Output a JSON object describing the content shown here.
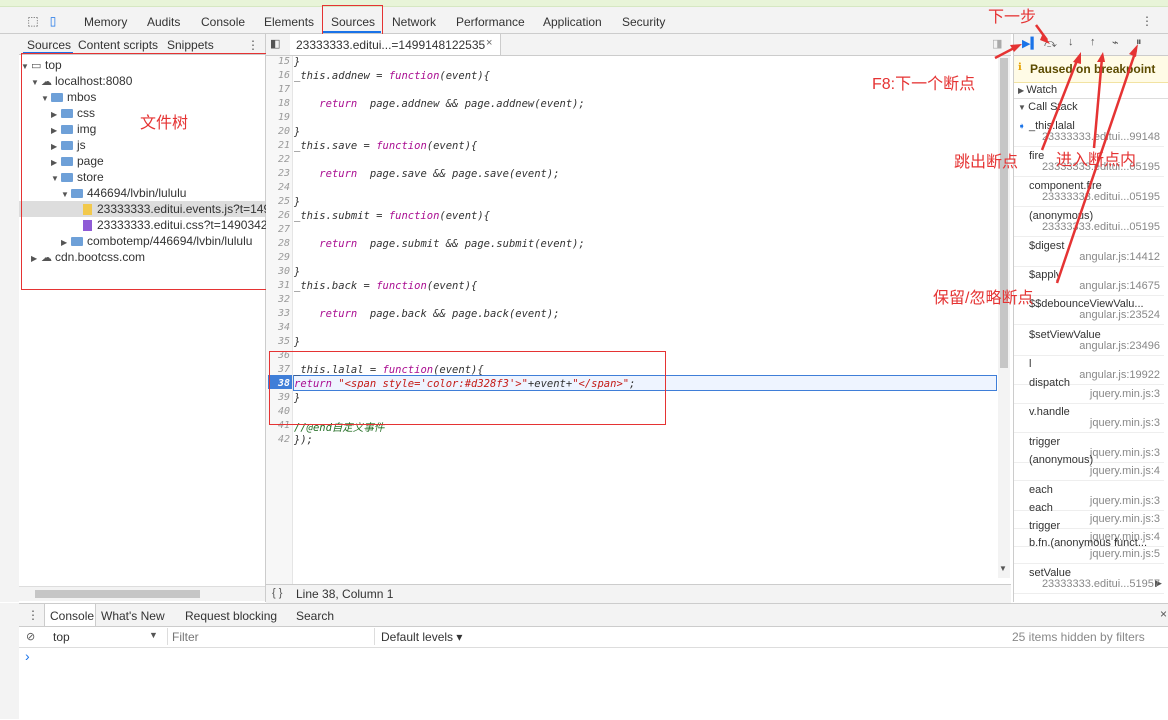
{
  "topbar": {
    "tabs": [
      "Memory",
      "Audits",
      "Console",
      "Elements",
      "Sources",
      "Network",
      "Performance",
      "Application",
      "Security"
    ],
    "active_tab": "Sources"
  },
  "sidebar": {
    "subtabs": [
      "Sources",
      "Content scripts",
      "Snippets"
    ],
    "tree": [
      {
        "label": "top",
        "kind": "frame"
      },
      {
        "label": "localhost:8080",
        "kind": "cloud"
      },
      {
        "label": "mbos",
        "kind": "folder"
      },
      {
        "label": "css",
        "kind": "folder"
      },
      {
        "label": "img",
        "kind": "folder"
      },
      {
        "label": "js",
        "kind": "folder"
      },
      {
        "label": "page",
        "kind": "folder"
      },
      {
        "label": "store",
        "kind": "folder"
      },
      {
        "label": "446694/lvbin/lululu",
        "kind": "folder"
      },
      {
        "label": "23333333.editui.events.js?t=149",
        "kind": "js"
      },
      {
        "label": "23333333.editui.css?t=1490342",
        "kind": "css"
      },
      {
        "label": "combotemp/446694/lvbin/lululu",
        "kind": "folder"
      },
      {
        "label": "cdn.bootcss.com",
        "kind": "cloud"
      }
    ]
  },
  "editor": {
    "tab_label": "23333333.editui...=1499148122535",
    "status": "Line 38, Column 1",
    "lines": [
      {
        "n": "15",
        "text": "}"
      },
      {
        "n": "16",
        "text": "_this.addnew = function(event){"
      },
      {
        "n": "17",
        "text": ""
      },
      {
        "n": "18",
        "text": "    return  page.addnew && page.addnew(event);"
      },
      {
        "n": "19",
        "text": ""
      },
      {
        "n": "20",
        "text": "}"
      },
      {
        "n": "21",
        "text": "_this.save = function(event){"
      },
      {
        "n": "22",
        "text": ""
      },
      {
        "n": "23",
        "text": "    return  page.save && page.save(event);"
      },
      {
        "n": "24",
        "text": ""
      },
      {
        "n": "25",
        "text": "}"
      },
      {
        "n": "26",
        "text": "_this.submit = function(event){"
      },
      {
        "n": "27",
        "text": ""
      },
      {
        "n": "28",
        "text": "    return  page.submit && page.submit(event);"
      },
      {
        "n": "29",
        "text": ""
      },
      {
        "n": "30",
        "text": "}"
      },
      {
        "n": "31",
        "text": "_this.back = function(event){"
      },
      {
        "n": "32",
        "text": ""
      },
      {
        "n": "33",
        "text": "    return  page.back && page.back(event);"
      },
      {
        "n": "34",
        "text": ""
      },
      {
        "n": "35",
        "text": "}"
      },
      {
        "n": "36",
        "text": ""
      },
      {
        "n": "37",
        "text": "_this.lalal = function(event){"
      },
      {
        "n": "38",
        "text": "return \"<span style='color:#d328f3'>\"+event+\"</span>\";"
      },
      {
        "n": "39",
        "text": "}"
      },
      {
        "n": "40",
        "text": ""
      },
      {
        "n": "41",
        "text": "//@end自定义事件"
      },
      {
        "n": "42",
        "text": "});"
      }
    ]
  },
  "debugger": {
    "paused_label": "Paused on breakpoint",
    "watch_label": "Watch",
    "callstack_label": "Call Stack",
    "frames": [
      {
        "name": "_this.lalal",
        "loc": "23333333.editui...99148"
      },
      {
        "name": "fire",
        "loc": "23333333.editui...05195"
      },
      {
        "name": "component.fire",
        "loc": "23333333.editui...05195"
      },
      {
        "name": "(anonymous)",
        "loc": "23333333.editui...05195"
      },
      {
        "name": "$digest",
        "loc": "angular.js:14412"
      },
      {
        "name": "$apply",
        "loc": "angular.js:14675"
      },
      {
        "name": "$$debounceViewValu...",
        "loc": "angular.js:23524"
      },
      {
        "name": "$setViewValue",
        "loc": "angular.js:23496"
      },
      {
        "name": "l",
        "loc": "angular.js:19922"
      },
      {
        "name": "dispatch",
        "loc": "jquery.min.js:3"
      },
      {
        "name": "v.handle",
        "loc": "jquery.min.js:3"
      },
      {
        "name": "trigger",
        "loc": "jquery.min.js:3"
      },
      {
        "name": "(anonymous)",
        "loc": "jquery.min.js:4"
      },
      {
        "name": "each",
        "loc": "jquery.min.js:3"
      },
      {
        "name": "each",
        "loc": "jquery.min.js:3"
      },
      {
        "name": "trigger",
        "loc": "jquery.min.js:4"
      },
      {
        "name": "b.fn.(anonymous funct...",
        "loc": "jquery.min.js:5"
      },
      {
        "name": "setValue",
        "loc": "23333333.editui...51957"
      }
    ]
  },
  "console": {
    "tabs": [
      "Console",
      "What's New",
      "Request blocking",
      "Search"
    ],
    "context": "top",
    "filter_placeholder": "Filter",
    "levels": "Default levels ▾",
    "hidden": "25 items hidden by filters",
    "prompt": "›"
  },
  "annotations": {
    "file_tree": "文件树",
    "next_step": "下一步",
    "f8": "F8:下一个断点",
    "step_out": "跳出断点",
    "step_into": "进入断点内",
    "toggle": "保留/忽略断点"
  },
  "colors": {
    "accent": "#1a73e8",
    "annotation": "#e53333",
    "paused_bg": "#fffbe6"
  }
}
